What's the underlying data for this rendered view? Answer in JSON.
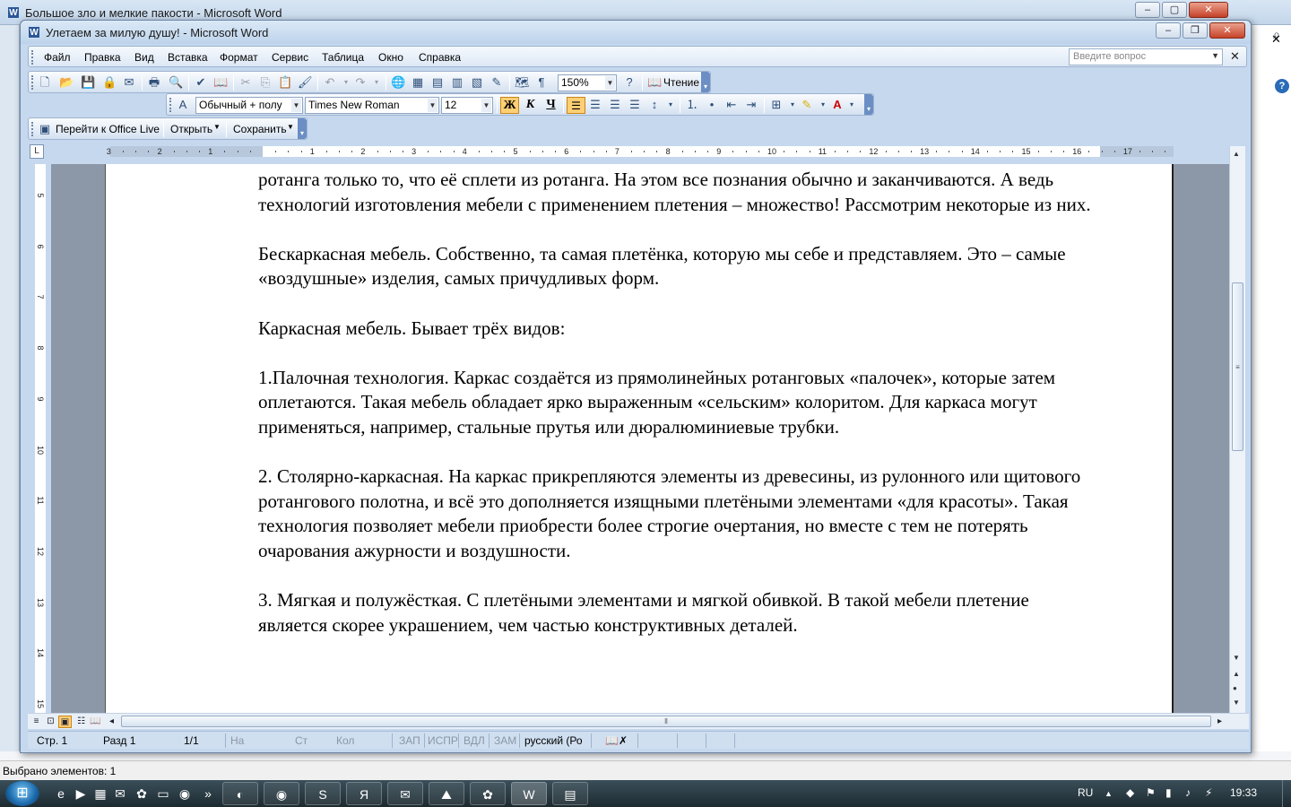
{
  "background_window": {
    "title": "Большое зло и мелкие пакости - Microsoft Word",
    "status_text": "Выбрано элементов: 1"
  },
  "window": {
    "title": "Улетаем за милую душу! - Microsoft Word"
  },
  "menu": {
    "items": [
      "Файл",
      "Правка",
      "Вид",
      "Вставка",
      "Формат",
      "Сервис",
      "Таблица",
      "Окно",
      "Справка"
    ],
    "help_placeholder": "Введите вопрос"
  },
  "toolbar_standard": {
    "zoom": "150%",
    "reading_label": "Чтение"
  },
  "toolbar_formatting": {
    "style": "Обычный + полу",
    "font": "Times New Roman",
    "size": "12",
    "bold": "Ж",
    "italic": "К",
    "underline": "Ч"
  },
  "toolbar_live": {
    "office_live": "Перейти к Office Live",
    "open": "Открыть",
    "save": "Сохранить"
  },
  "ruler": {
    "numbers": [
      "3",
      "2",
      "1",
      "1",
      "2",
      "3",
      "4",
      "5",
      "6",
      "7",
      "8",
      "9",
      "10",
      "11",
      "12",
      "13",
      "14",
      "15",
      "16",
      "17"
    ]
  },
  "vertical_ruler": {
    "numbers": [
      "5",
      "6",
      "7",
      "8",
      "9",
      "10",
      "11",
      "12",
      "13",
      "14",
      "15"
    ]
  },
  "document": {
    "paragraphs": [
      "ротанга только то, что её сплети из ротанга. На этом все познания обычно и заканчиваются. А ведь технологий изготовления мебели с применением плетения – множество! Рассмотрим некоторые из них.",
      "Бескаркасная мебель. Собственно, та самая плетёнка, которую мы себе и представляем. Это – самые «воздушные» изделия, самых причудливых форм.",
      "Каркасная мебель. Бывает трёх видов:",
      "1.Палочная технология. Каркас создаётся из прямолинейных ротанговых «палочек», которые затем оплетаются. Такая мебель обладает ярко выраженным «сельским» колоритом. Для каркаса могут применяться, например, стальные прутья или дюралюминиевые трубки.",
      "2. Столярно-каркасная. На каркас прикрепляются элементы из древесины, из рулонного или щитового ротангового полотна, и всё это дополняется изящными плетёными элементами «для красоты». Такая технология позволяет мебели приобрести более строгие очертания, но вместе с тем не потерять очарования ажурности и воздушности.",
      "3. Мягкая и полужёсткая. С плетёными элементами и мягкой обивкой. В такой мебели плетение является скорее украшением, чем частью конструктивных деталей."
    ]
  },
  "statusbar": {
    "page": "Стр. 1",
    "section": "Разд 1",
    "pages": "1/1",
    "at": "На",
    "line": "Ст",
    "col": "Кол",
    "rec": "ЗАП",
    "trk": "ИСПР",
    "ext": "ВДЛ",
    "ovr": "ЗАМ",
    "language": "русский (Ро"
  },
  "taskbar": {
    "language": "RU",
    "clock": "19:33"
  }
}
